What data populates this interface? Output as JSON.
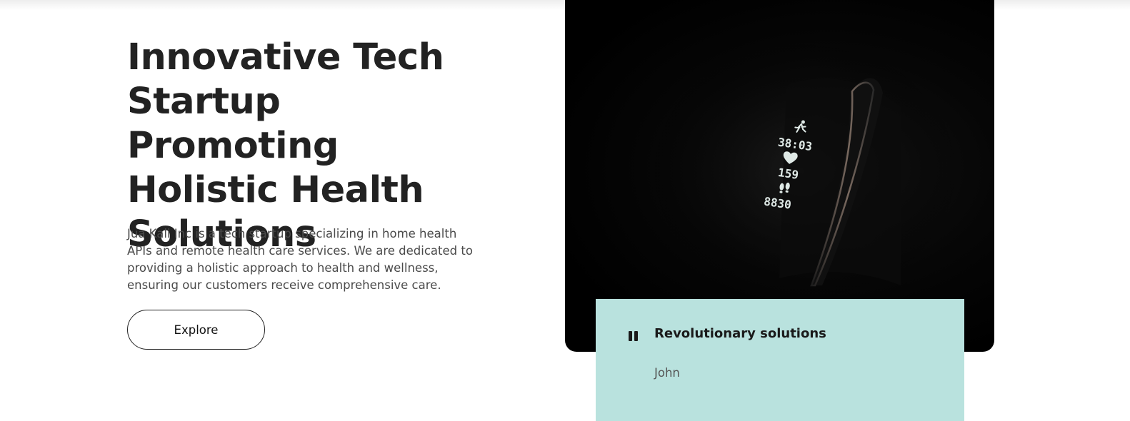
{
  "hero": {
    "title": "Innovative Tech Startup Promoting Holistic Health Solutions",
    "description": "Jua Kali Inc is a tech startup specializing in home health APIs and remote health care services. We are dedicated to providing a holistic approach to health and wellness, ensuring our customers receive comprehensive care.",
    "explore_label": "Explore"
  },
  "image": {
    "watch_readouts": [
      "38:03",
      "159",
      "8830"
    ],
    "icons": [
      "running-icon",
      "heart-icon",
      "footsteps-icon"
    ]
  },
  "card": {
    "title": "Revolutionary solutions",
    "author": "John",
    "background": "#b9e2de",
    "control_icon": "pause-icon"
  }
}
